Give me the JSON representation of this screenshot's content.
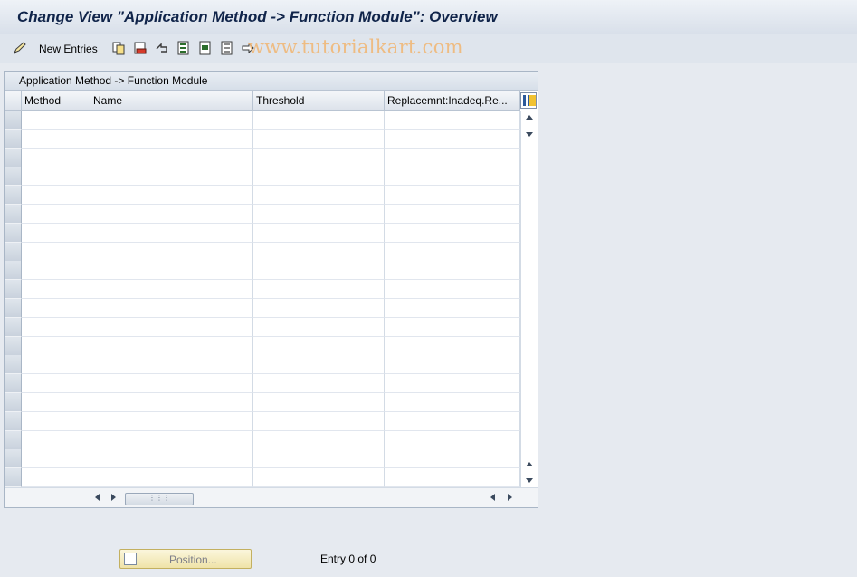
{
  "window": {
    "title": "Change View \"Application Method -> Function Module\": Overview"
  },
  "toolbar": {
    "new_entries_label": "New Entries",
    "icons": [
      "edit-pen-icon",
      "copy-icon",
      "delete-icon",
      "undo-icon",
      "select-all-icon",
      "select-block-icon",
      "deselect-all-icon",
      "navigate-icon"
    ]
  },
  "watermark": "www.tutorialkart.com",
  "table": {
    "title": "Application Method -> Function Module",
    "columns": [
      "Method",
      "Name",
      "Threshold",
      "Replacemnt:Inadeq.Re..."
    ],
    "row_count": 20
  },
  "footer": {
    "position_button_label": "Position...",
    "entry_info": "Entry 0 of 0"
  },
  "colors": {
    "title_text": "#10244a",
    "background": "#e6eaf0",
    "position_button": "#f3e9b8",
    "watermark": "#f0b878"
  }
}
